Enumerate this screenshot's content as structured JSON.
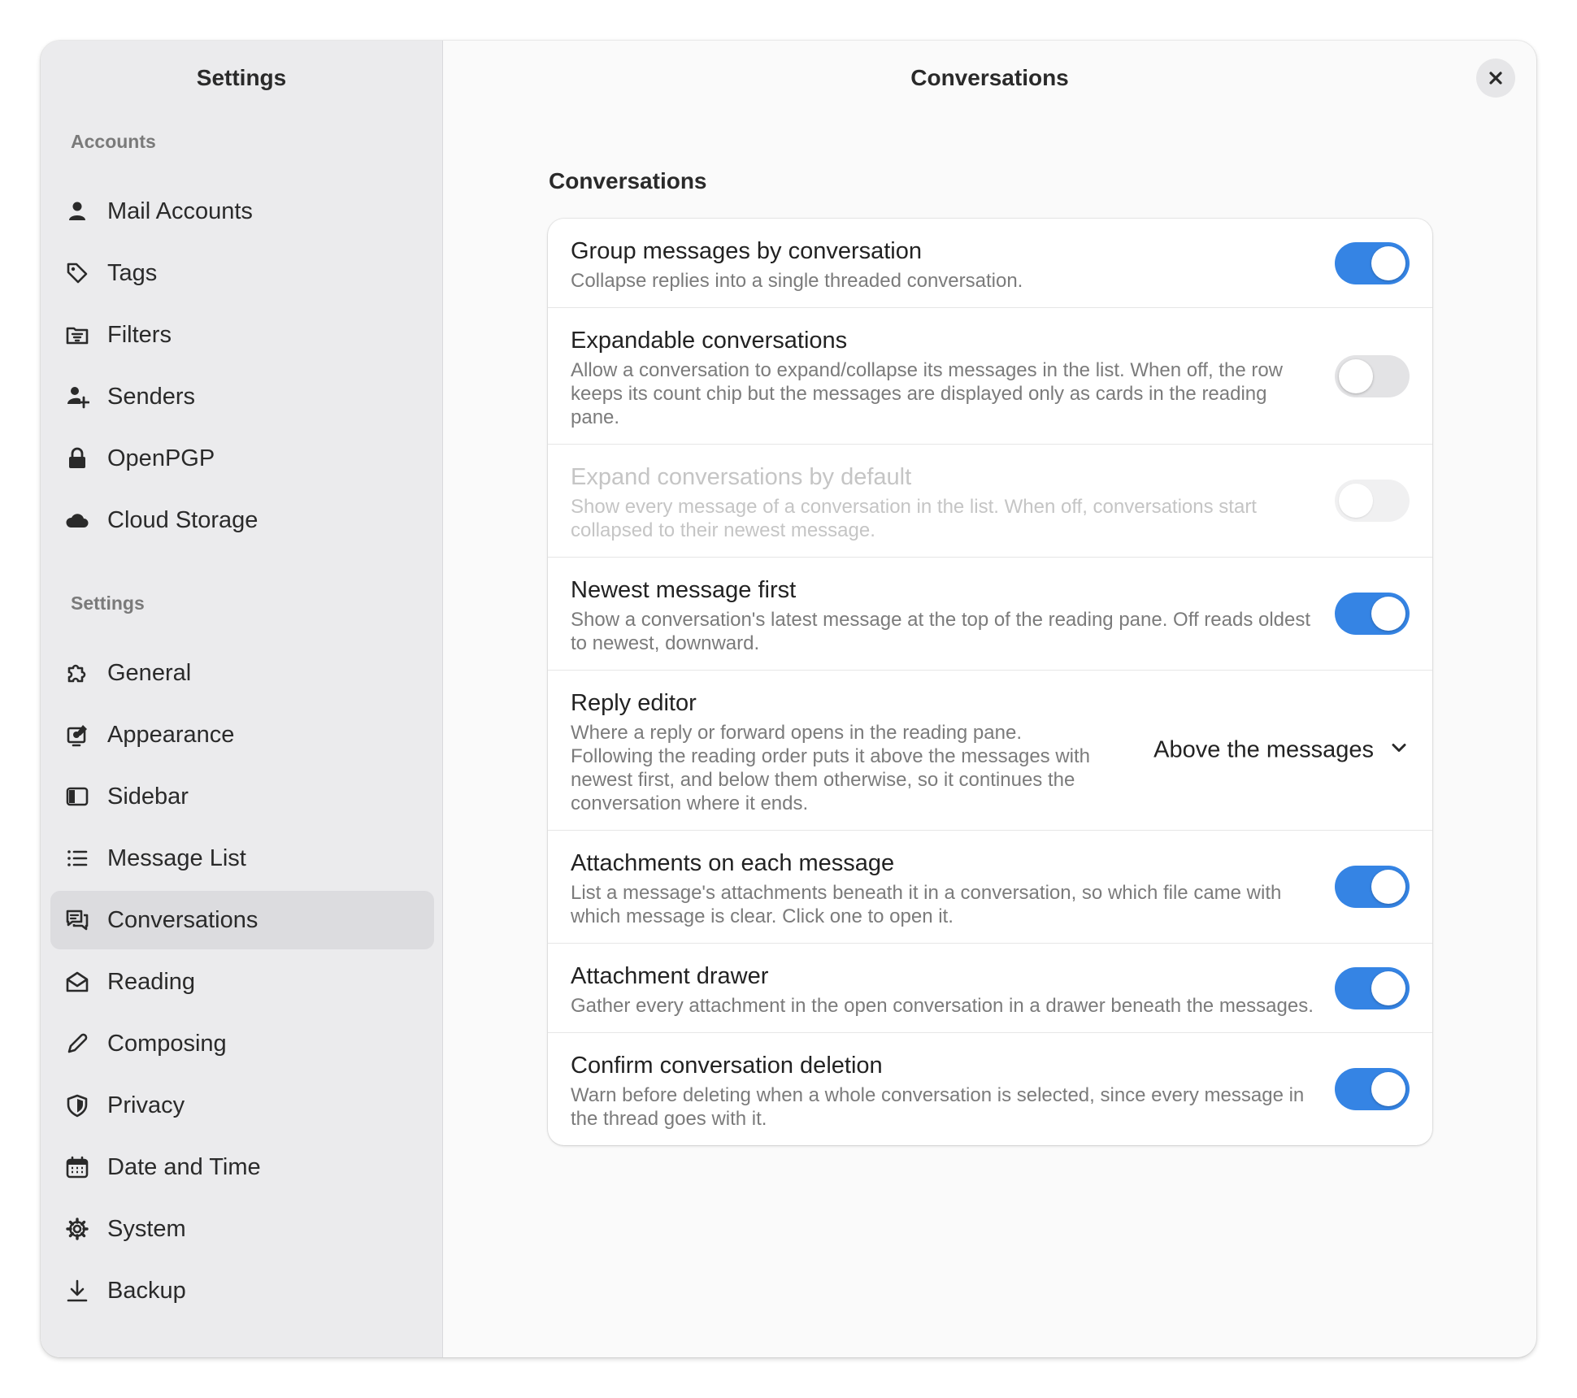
{
  "sidebar": {
    "title": "Settings",
    "sections": [
      {
        "heading": "Accounts",
        "items": [
          {
            "label": "Mail Accounts",
            "icon": "person-icon"
          },
          {
            "label": "Tags",
            "icon": "tag-icon"
          },
          {
            "label": "Filters",
            "icon": "filter-icon"
          },
          {
            "label": "Senders",
            "icon": "person-add-icon"
          },
          {
            "label": "OpenPGP",
            "icon": "lock-icon"
          },
          {
            "label": "Cloud Storage",
            "icon": "cloud-icon"
          }
        ]
      },
      {
        "heading": "Settings",
        "items": [
          {
            "label": "General",
            "icon": "puzzle-icon"
          },
          {
            "label": "Appearance",
            "icon": "appearance-icon"
          },
          {
            "label": "Sidebar",
            "icon": "sidebar-icon"
          },
          {
            "label": "Message List",
            "icon": "list-icon"
          },
          {
            "label": "Conversations",
            "icon": "chat-icon",
            "active": true
          },
          {
            "label": "Reading",
            "icon": "envelope-open-icon"
          },
          {
            "label": "Composing",
            "icon": "pencil-icon"
          },
          {
            "label": "Privacy",
            "icon": "shield-icon"
          },
          {
            "label": "Date and Time",
            "icon": "calendar-icon"
          },
          {
            "label": "System",
            "icon": "gear-icon"
          },
          {
            "label": "Backup",
            "icon": "download-icon"
          }
        ]
      }
    ]
  },
  "main": {
    "title": "Conversations",
    "close_icon": "close-icon",
    "group_title": "Conversations",
    "rows": [
      {
        "title": "Group messages by conversation",
        "subtitle": "Collapse replies into a single threaded conversation.",
        "control": "switch",
        "on": true
      },
      {
        "title": "Expandable conversations",
        "subtitle": "Allow a conversation to expand/collapse its messages in the list. When off, the row keeps its count chip but the messages are displayed only as cards in the reading pane.",
        "control": "switch",
        "on": false
      },
      {
        "title": "Expand conversations by default",
        "subtitle": "Show every message of a conversation in the list. When off, conversations start collapsed to their newest message.",
        "control": "switch",
        "on": false,
        "disabled": true
      },
      {
        "title": "Newest message first",
        "subtitle": "Show a conversation's latest message at the top of the reading pane. Off reads oldest to newest, downward.",
        "control": "switch",
        "on": true
      },
      {
        "title": "Reply editor",
        "subtitle": "Where a reply or forward opens in the reading pane. Following the reading order puts it above the messages with newest first, and below them otherwise, so it continues the conversation where it ends.",
        "control": "dropdown",
        "value": "Above the messages"
      },
      {
        "title": "Attachments on each message",
        "subtitle": "List a message's attachments beneath it in a conversation, so which file came with which message is clear. Click one to open it.",
        "control": "switch",
        "on": true
      },
      {
        "title": "Attachment drawer",
        "subtitle": "Gather every attachment in the open conversation in a drawer beneath the messages.",
        "control": "switch",
        "on": true
      },
      {
        "title": "Confirm conversation deletion",
        "subtitle": "Warn before deleting when a whole conversation is selected, since every message in the thread goes with it.",
        "control": "switch",
        "on": true
      }
    ]
  },
  "colors": {
    "accent": "#3584e4",
    "sidebar_bg": "#ebebed",
    "active_item_bg": "#dcdcdf"
  }
}
